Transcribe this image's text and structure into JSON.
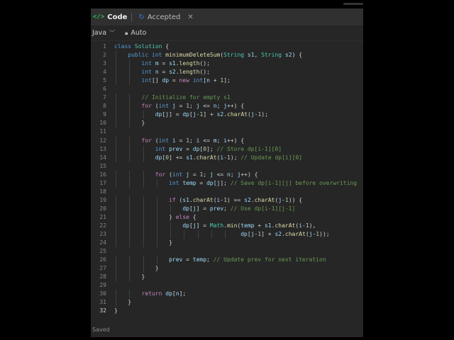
{
  "header": {
    "tabs": [
      {
        "label": "Code",
        "icon": "code-icon"
      },
      {
        "label": "Accepted",
        "icon": "accepted-icon"
      }
    ],
    "close_icon": "close-icon"
  },
  "toolbar": {
    "language": "Java",
    "mode": "Auto"
  },
  "editor": {
    "lines": [
      "class Solution {",
      "    public int minimumDeleteSum(String s1, String s2) {",
      "        int m = s1.length();",
      "        int n = s2.length();",
      "        int[] dp = new int[n + 1];",
      "",
      "        // Initialize for empty s1",
      "        for (int j = 1; j <= n; j++) {",
      "            dp[j] = dp[j-1] + s2.charAt(j-1);",
      "        }",
      "",
      "        for (int i = 1; i <= m; i++) {",
      "            int prev = dp[0]; // Store dp[i-1][0]",
      "            dp[0] += s1.charAt(i-1); // Update dp[i][0]",
      "",
      "            for (int j = 1; j <= n; j++) {",
      "                int temp = dp[j]; // Save dp[i-1][j] before overwriting",
      "",
      "                if (s1.charAt(i-1) == s2.charAt(j-1)) {",
      "                    dp[j] = prev; // Use dp[i-1][j-1]",
      "                } else {",
      "                    dp[j] = Math.min(temp + s1.charAt(i-1),",
      "                                     dp[j-1] + s2.charAt(j-1));",
      "                }",
      "",
      "                prev = temp; // Update prev for next iteration",
      "            }",
      "        }",
      "",
      "        return dp[n];",
      "    }",
      "}"
    ],
    "active_line": 32
  },
  "status": {
    "text": "Saved"
  }
}
